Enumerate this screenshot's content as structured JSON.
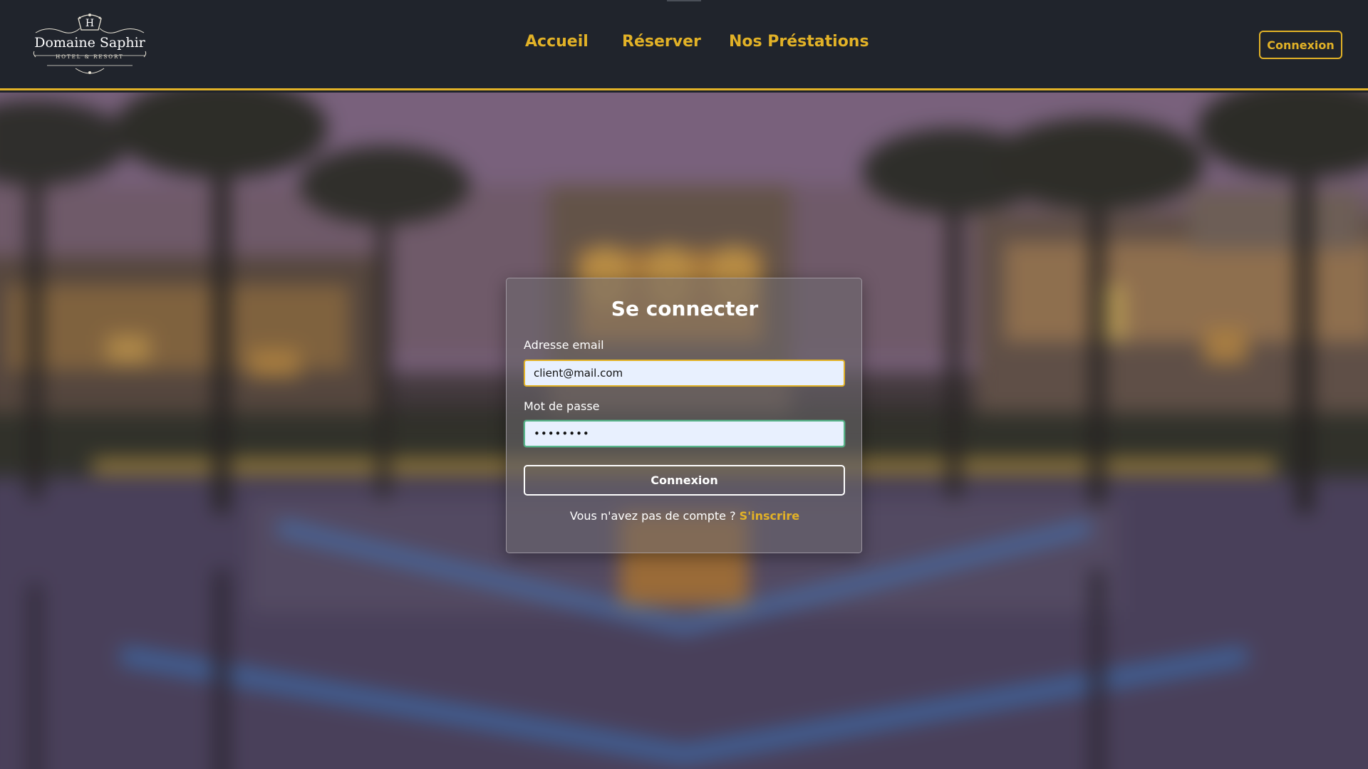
{
  "brand": {
    "name": "Domaine Saphir",
    "tagline": "HOTEL & RESORT",
    "monogram": "H"
  },
  "nav": {
    "items": [
      {
        "label": "Accueil"
      },
      {
        "label": "Réserver"
      },
      {
        "label": "Nos Préstations"
      }
    ],
    "login_button": "Connexion"
  },
  "login": {
    "title": "Se connecter",
    "email_label": "Adresse email",
    "email_value": "client@mail.com",
    "password_label": "Mot de passe",
    "password_value": "••••••••",
    "submit_label": "Connexion",
    "signup_prompt": "Vous n'avez pas de compte ?",
    "signup_link": "S'inscrire"
  },
  "colors": {
    "accent": "#e2b227",
    "header_bg": "#20242c",
    "focus_border": "#57b58a"
  }
}
